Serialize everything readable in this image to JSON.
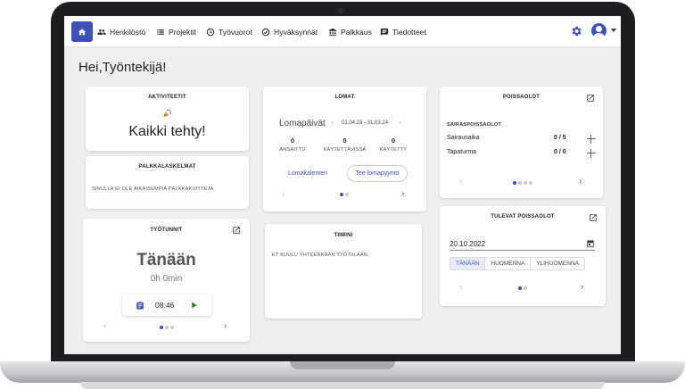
{
  "nav": {
    "items": [
      {
        "label": "Henkilöstö",
        "icon": "people-icon"
      },
      {
        "label": "Projektit",
        "icon": "list-icon"
      },
      {
        "label": "Työvuorot",
        "icon": "clock-icon"
      },
      {
        "label": "Hyväksynnät",
        "icon": "check-circle-icon"
      },
      {
        "label": "Palkkaus",
        "icon": "bank-icon"
      },
      {
        "label": "Tiedotteet",
        "icon": "message-icon"
      }
    ]
  },
  "greeting": "Hei,Työntekijä!",
  "activities": {
    "title": "AKTIVITEETIT",
    "message": "Kaikki tehty!",
    "icon": "party-popper-icon"
  },
  "payslips": {
    "title": "PALKKALASKELMAT",
    "empty": "SINULLA EI OLE AIKAISEMPIA PALKKAKUITTEJA"
  },
  "hours": {
    "title": "TYÖTUNNIT",
    "day": "Tänään",
    "duration": "0h 0min",
    "clock_time": "08:46"
  },
  "holidays": {
    "title": "LOMAT",
    "subtitle": "Lomapäivät",
    "period": "01.04.23 - 31.03.24",
    "stats": [
      {
        "value": "0",
        "label": "ANSAITTU"
      },
      {
        "value": "0",
        "label": "KÄYTETTÄVISSÄ"
      },
      {
        "value": "0",
        "label": "KÄYTETTY"
      }
    ],
    "calendar_link": "Lomakalenteri",
    "request_button": "Tee lomapyyntö"
  },
  "team": {
    "title": "TIIMINI",
    "empty": "ET KUULU YHTEENKÄÄN TYÖTIILAAN."
  },
  "absences": {
    "title": "POISSAOLOT",
    "section": "SAIRASPOISSAOLOT",
    "rows": [
      {
        "label": "Sairausaika",
        "value": "0 / 5"
      },
      {
        "label": "Tapaturma",
        "value": "0 / 0"
      }
    ]
  },
  "upcoming": {
    "title": "TULEVAT POISSAOLOT",
    "date": "20.10.2022",
    "tabs": [
      "TÄNÄÄN",
      "HUOMENNA",
      "YLIHUOMENNA"
    ]
  },
  "colors": {
    "accent": "#3f51b5",
    "play": "#2e7d32"
  }
}
